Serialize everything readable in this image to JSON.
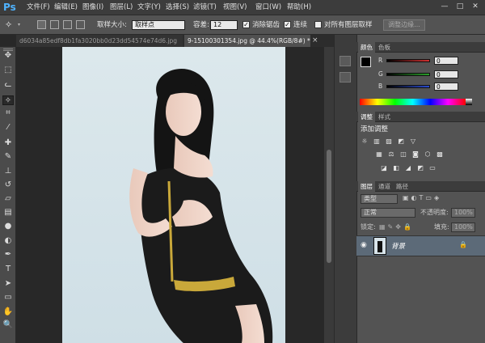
{
  "app": {
    "logo": "Ps"
  },
  "menu": [
    "文件(F)",
    "编辑(E)",
    "图像(I)",
    "图层(L)",
    "文字(Y)",
    "选择(S)",
    "滤镜(T)",
    "视图(V)",
    "窗口(W)",
    "帮助(H)"
  ],
  "window_controls": {
    "minimize": "—",
    "maximize": "□",
    "close": "✕"
  },
  "options": {
    "sample_size_label": "取样大小:",
    "sample_size_value": "取样点",
    "tolerance_label": "容差:",
    "tolerance_value": "12",
    "antialias_label": "消除锯齿",
    "antialias_checked": true,
    "contiguous_label": "连续",
    "contiguous_checked": true,
    "all_layers_label": "对所有图层取样",
    "all_layers_checked": false,
    "refine_edge_label": "调整边缘..."
  },
  "document_tabs": [
    {
      "label": "d6034a85edf8db1fa3020bb0d23dd54574e74d6.jpg",
      "active": false
    },
    {
      "label": "9-15100301354.jpg @ 44.4%(RGB/8#) *",
      "close": "×",
      "active": true
    }
  ],
  "tools": [
    {
      "name": "move-tool-icon",
      "glyph": "✥"
    },
    {
      "name": "marquee-tool-icon",
      "glyph": "⬚"
    },
    {
      "name": "lasso-tool-icon",
      "glyph": "ᓚ"
    },
    {
      "name": "magic-wand-tool-icon",
      "glyph": "✧"
    },
    {
      "name": "crop-tool-icon",
      "glyph": "⌗"
    },
    {
      "name": "eyedropper-tool-icon",
      "glyph": "⁄"
    },
    {
      "name": "healing-brush-icon",
      "glyph": "✚"
    },
    {
      "name": "brush-tool-icon",
      "glyph": "✎"
    },
    {
      "name": "clone-stamp-icon",
      "glyph": "⊥"
    },
    {
      "name": "history-brush-icon",
      "glyph": "↺"
    },
    {
      "name": "eraser-tool-icon",
      "glyph": "▱"
    },
    {
      "name": "gradient-tool-icon",
      "glyph": "▤"
    },
    {
      "name": "blur-tool-icon",
      "glyph": "●"
    },
    {
      "name": "dodge-tool-icon",
      "glyph": "◐"
    },
    {
      "name": "pen-tool-icon",
      "glyph": "✒"
    },
    {
      "name": "type-tool-icon",
      "glyph": "T"
    },
    {
      "name": "path-select-icon",
      "glyph": "➤"
    },
    {
      "name": "shape-tool-icon",
      "glyph": "▭"
    },
    {
      "name": "hand-tool-icon",
      "glyph": "✋"
    },
    {
      "name": "zoom-tool-icon",
      "glyph": "🔍"
    }
  ],
  "color_panel": {
    "tabs": [
      "颜色",
      "色板"
    ],
    "channels": [
      {
        "label": "R",
        "value": "0",
        "color": "#d03030"
      },
      {
        "label": "G",
        "value": "0",
        "color": "#2aa02a"
      },
      {
        "label": "B",
        "value": "0",
        "color": "#2a4bd0"
      }
    ]
  },
  "adjust_panel": {
    "tabs": [
      "调整",
      "样式"
    ],
    "title": "添加调整",
    "row1": [
      "☼",
      "▥",
      "▨",
      "◩",
      "▽"
    ],
    "row2": [
      "▦",
      "⚖",
      "◫",
      "◙",
      "⬡",
      "▩"
    ],
    "row3": [
      "◪",
      "◧",
      "◢",
      "◩",
      "▭"
    ]
  },
  "layers_panel": {
    "tabs": [
      "图层",
      "通道",
      "路径"
    ],
    "kind_label": "类型",
    "blend_mode": "正常",
    "opacity_label": "不透明度:",
    "opacity_value": "100%",
    "lock_label": "锁定:",
    "fill_label": "填充:",
    "fill_value": "100%",
    "layer_name": "背景",
    "layer_color": "#5c6a78"
  }
}
